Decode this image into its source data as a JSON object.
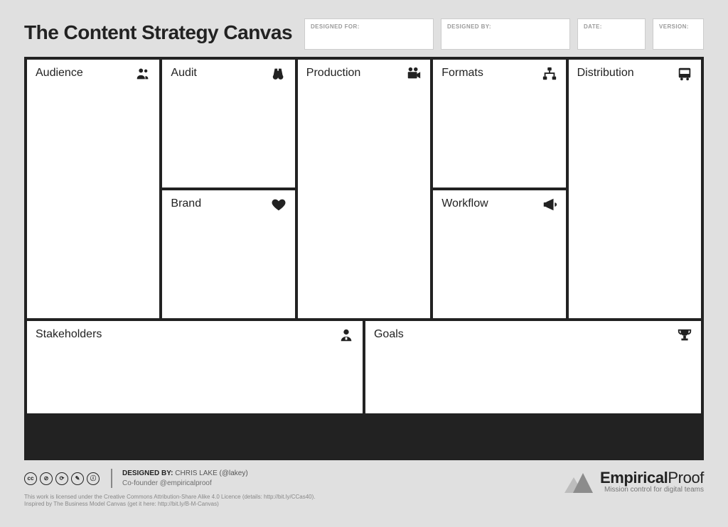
{
  "title": "The Content Strategy Canvas",
  "meta": {
    "designed_for_label": "DESIGNED FOR:",
    "designed_by_label": "DESIGNED BY:",
    "date_label": "DATE:",
    "version_label": "VERSION:"
  },
  "cells": {
    "audience": "Audience",
    "audit": "Audit",
    "brand": "Brand",
    "production": "Production",
    "formats": "Formats",
    "workflow": "Workflow",
    "distribution": "Distribution",
    "stakeholders": "Stakeholders",
    "goals": "Goals"
  },
  "footer": {
    "credit_prefix": "DESIGNED BY: ",
    "credit_name": "CHRIS LAKE (@lakey)",
    "credit_role": "Co-founder @empiricalproof",
    "fineprint1": "This work is licensed under the Creative Commons Attribution-Share Alike 4.0 Licence (details: http://bit.ly/CCas40).",
    "fineprint2": "Inspired by The Business Model Canvas (get it here: http://bit.ly/B-M-Canvas)",
    "brand_bold": "Empirical",
    "brand_light": "Proof",
    "tagline": "Mission control for digital teams",
    "cc_badges": [
      "cc",
      "⊘",
      "⟳",
      "✎",
      "ⓘ"
    ]
  }
}
